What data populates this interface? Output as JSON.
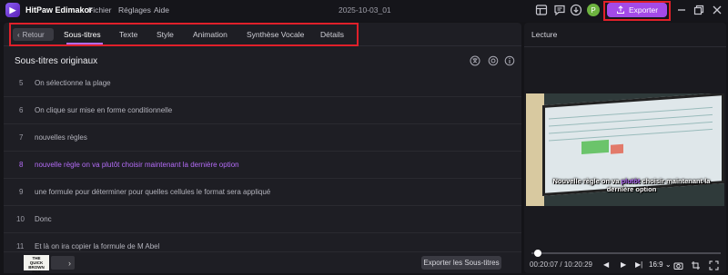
{
  "app": {
    "name": "HitPaw Edimakor",
    "menu": [
      "Fichier",
      "Réglages",
      "Aide"
    ],
    "document_title": "2025-10-03_01",
    "user_initial": "P",
    "export_label": "Exporter",
    "accent": "#b46cf7",
    "highlight_outline": "#e0202a"
  },
  "tabs": {
    "back_label": "Retour",
    "items": [
      "Sous-titres",
      "Texte",
      "Style",
      "Animation",
      "Synthèse Vocale",
      "Détails"
    ],
    "active": "Sous-titres"
  },
  "subtitles": {
    "title": "Sous-titres originaux",
    "rows": [
      {
        "num": "5",
        "text": "On sélectionne la plage"
      },
      {
        "num": "6",
        "text": "On clique sur mise en forme conditionnelle"
      },
      {
        "num": "7",
        "text": "nouvelles règles"
      },
      {
        "num": "8",
        "text": "nouvelle règle  on va plutôt choisir maintenant la dernière option",
        "highlighted": true
      },
      {
        "num": "9",
        "text": "une formule pour déterminer pour quelles cellules le format sera appliqué"
      },
      {
        "num": "10",
        "text": "Donc"
      },
      {
        "num": "11",
        "text": "Et là  on ira copier la formule de M  Abel"
      }
    ],
    "thumbnail_text": [
      "THE",
      "QUICK",
      "BROWN FOX"
    ],
    "export_label": "Exporter les Sous-titres"
  },
  "player": {
    "title": "Lecture",
    "caption_pre": "Nouvelle règle  on va ",
    "caption_highlight": "plutôt",
    "caption_post": " choisir maintenant la dernière option",
    "current_time": "00:20:07",
    "separator": "/",
    "total_time": "10:20:29",
    "aspect_ratio": "16:9",
    "progress": 0.032
  }
}
